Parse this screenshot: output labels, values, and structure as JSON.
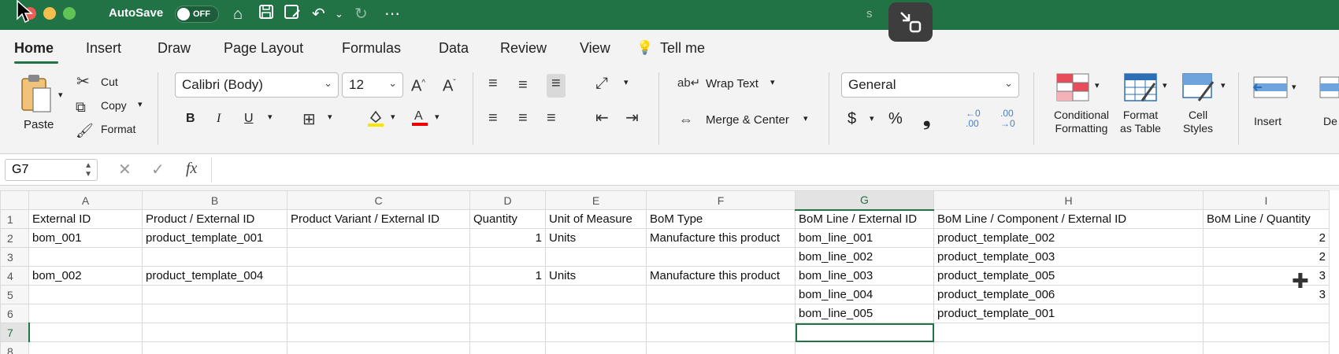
{
  "titlebar": {
    "autosave_label": "AutoSave",
    "autosave_state": "OFF",
    "doc_title": "s",
    "accent": "#217346"
  },
  "tabs": [
    {
      "label": "Home"
    },
    {
      "label": "Insert"
    },
    {
      "label": "Draw"
    },
    {
      "label": "Page Layout"
    },
    {
      "label": "Formulas"
    },
    {
      "label": "Data"
    },
    {
      "label": "Review"
    },
    {
      "label": "View"
    },
    {
      "label": "Tell me"
    }
  ],
  "ribbon": {
    "paste": "Paste",
    "cut": "Cut",
    "copy": "Copy",
    "format": "Format",
    "font_name": "Calibri (Body)",
    "font_size": "12",
    "bold": "B",
    "italic": "I",
    "underline": "U",
    "wrap_text": "Wrap Text",
    "merge_center": "Merge & Center",
    "number_format": "General",
    "currency": "$",
    "percent": "%",
    "comma": "❟",
    "conditional_formatting": [
      "Conditional",
      "Formatting"
    ],
    "format_as_table": [
      "Format",
      "as Table"
    ],
    "cell_styles": [
      "Cell",
      "Styles"
    ],
    "insert": "Insert",
    "delete_partial": "De"
  },
  "formula_bar": {
    "name_box": "G7",
    "fx": "fx",
    "value": ""
  },
  "sheet": {
    "columns": [
      "A",
      "B",
      "C",
      "D",
      "E",
      "F",
      "G",
      "H",
      "I"
    ],
    "rows": [
      {
        "n": "1",
        "cells": [
          "External ID",
          "Product / External ID",
          "Product Variant / External ID",
          "Quantity",
          "Unit of Measure",
          "BoM Type",
          "BoM Line / External ID",
          "BoM Line / Component / External ID",
          "BoM Line / Quantity"
        ]
      },
      {
        "n": "2",
        "cells": [
          "bom_001",
          "product_template_001",
          "",
          "1",
          "Units",
          "Manufacture this product",
          "bom_line_001",
          "product_template_002",
          "2"
        ]
      },
      {
        "n": "3",
        "cells": [
          "",
          "",
          "",
          "",
          "",
          "",
          "bom_line_002",
          "product_template_003",
          "2"
        ]
      },
      {
        "n": "4",
        "cells": [
          "bom_002",
          "product_template_004",
          "",
          "1",
          "Units",
          "Manufacture this product",
          "bom_line_003",
          "product_template_005",
          "3"
        ]
      },
      {
        "n": "5",
        "cells": [
          "",
          "",
          "",
          "",
          "",
          "",
          "bom_line_004",
          "product_template_006",
          "3"
        ]
      },
      {
        "n": "6",
        "cells": [
          "",
          "",
          "",
          "",
          "",
          "",
          "bom_line_005",
          "product_template_001",
          ""
        ]
      },
      {
        "n": "7",
        "cells": [
          "",
          "",
          "",
          "",
          "",
          "",
          "",
          "",
          ""
        ]
      },
      {
        "n": "8",
        "cells": [
          "",
          "",
          "",
          "",
          "",
          "",
          "",
          "",
          ""
        ]
      }
    ]
  }
}
